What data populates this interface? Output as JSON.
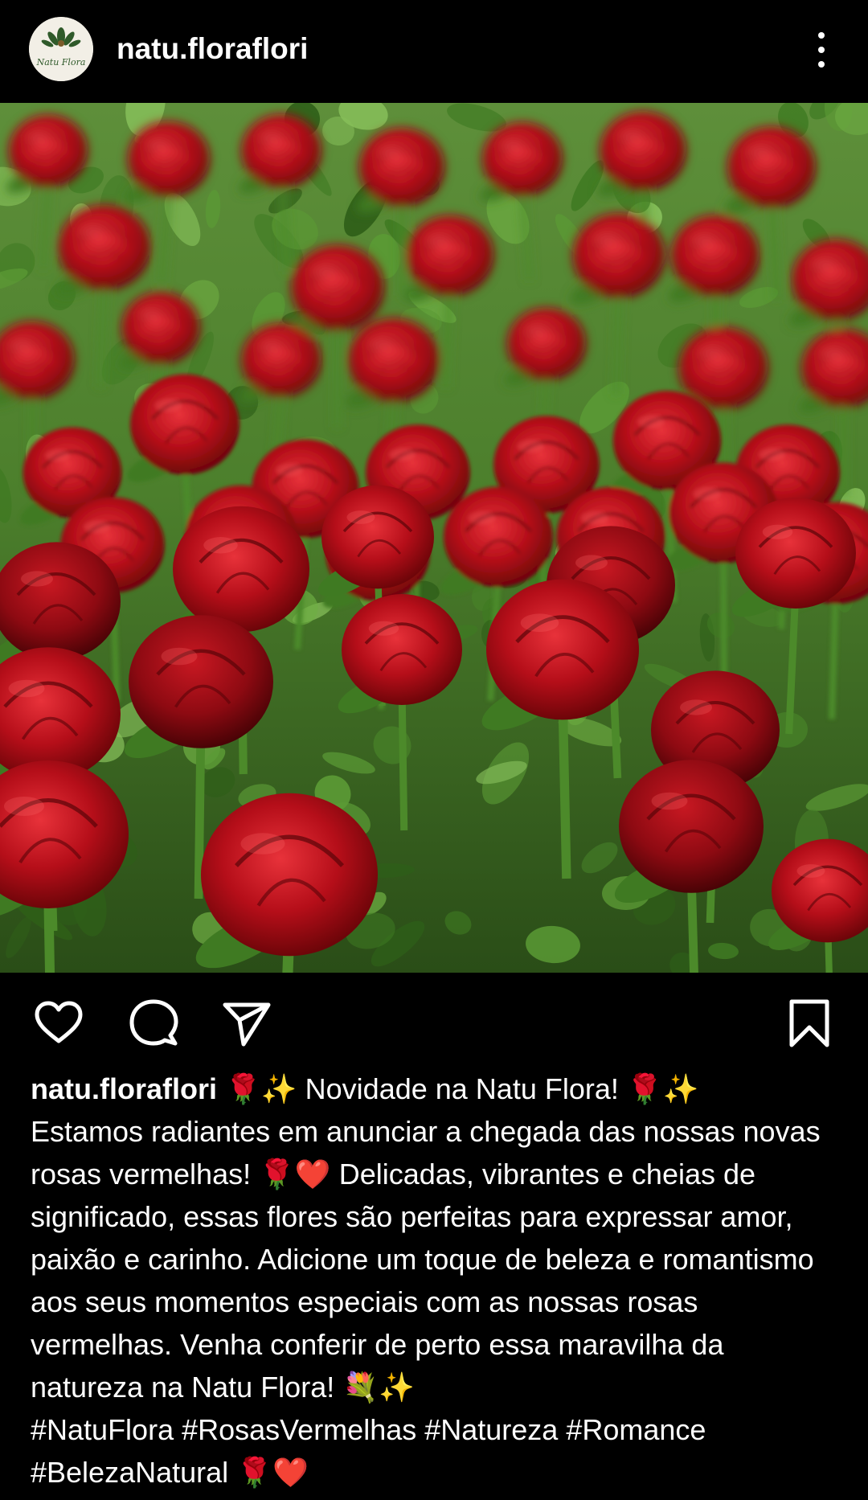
{
  "header": {
    "username": "natu.floraflori",
    "avatar_text": "Natu Flora",
    "more_icon": "more-vertical-icon"
  },
  "post": {
    "image_description_icon": "photo-image"
  },
  "actions": {
    "like_icon": "heart-icon",
    "comment_icon": "comment-icon",
    "share_icon": "send-icon",
    "save_icon": "bookmark-icon"
  },
  "caption": {
    "username": "natu.floraflori",
    "text": " 🌹✨ Novidade na Natu Flora! 🌹✨\nEstamos radiantes em anunciar a chegada das nossas novas rosas vermelhas! 🌹❤️ Delicadas, vibrantes e cheias de significado, essas flores são perfeitas para expressar amor, paixão e carinho. Adicione um toque de beleza e romantismo aos seus momentos especiais com as nossas rosas vermelhas. Venha conferir de perto essa maravilha da natureza na Natu Flora! 💐✨\n#NatuFlora #RosasVermelhas #Natureza #Romance\n#BelezaNatural 🌹❤️"
  },
  "colors": {
    "background": "#000000",
    "text": "#ffffff",
    "rose_red": "#c8101c",
    "leaf_green": "#3f7a22"
  }
}
